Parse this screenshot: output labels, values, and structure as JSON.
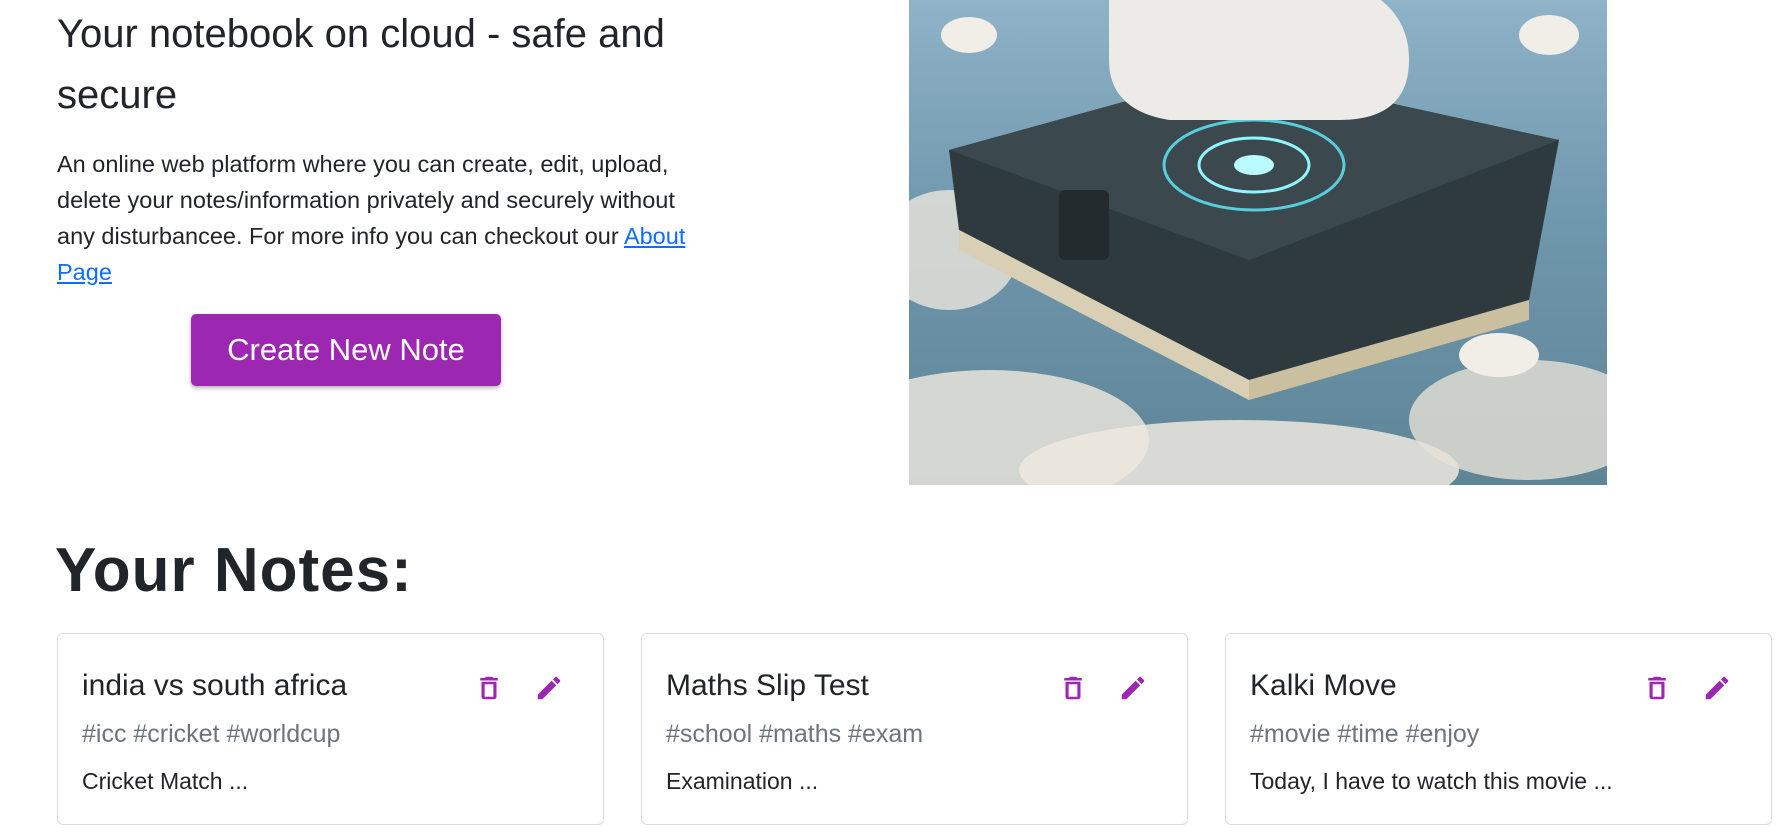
{
  "hero": {
    "title": "Your notebook on cloud - safe and secure",
    "text": "An online web platform where you can create, edit, upload, delete your notes/information privately and securely without any disturbancee. For more info you can checkout our ",
    "about_link": "About Page",
    "create_button": "Create New Note",
    "image_alt": "Notebook on cloud illustration"
  },
  "notes_heading": "Your Notes:",
  "accent_color": "#9c27b0",
  "notes": [
    {
      "title": "india vs south africa",
      "tags": "#icc #cricket #worldcup",
      "description": "Cricket Match ..."
    },
    {
      "title": "Maths Slip Test",
      "tags": "#school #maths #exam",
      "description": "Examination ..."
    },
    {
      "title": "Kalki Move",
      "tags": "#movie #time #enjoy",
      "description": "Today, I have to watch this movie ..."
    }
  ],
  "icons": {
    "delete": "trash-icon",
    "edit": "pencil-icon"
  }
}
